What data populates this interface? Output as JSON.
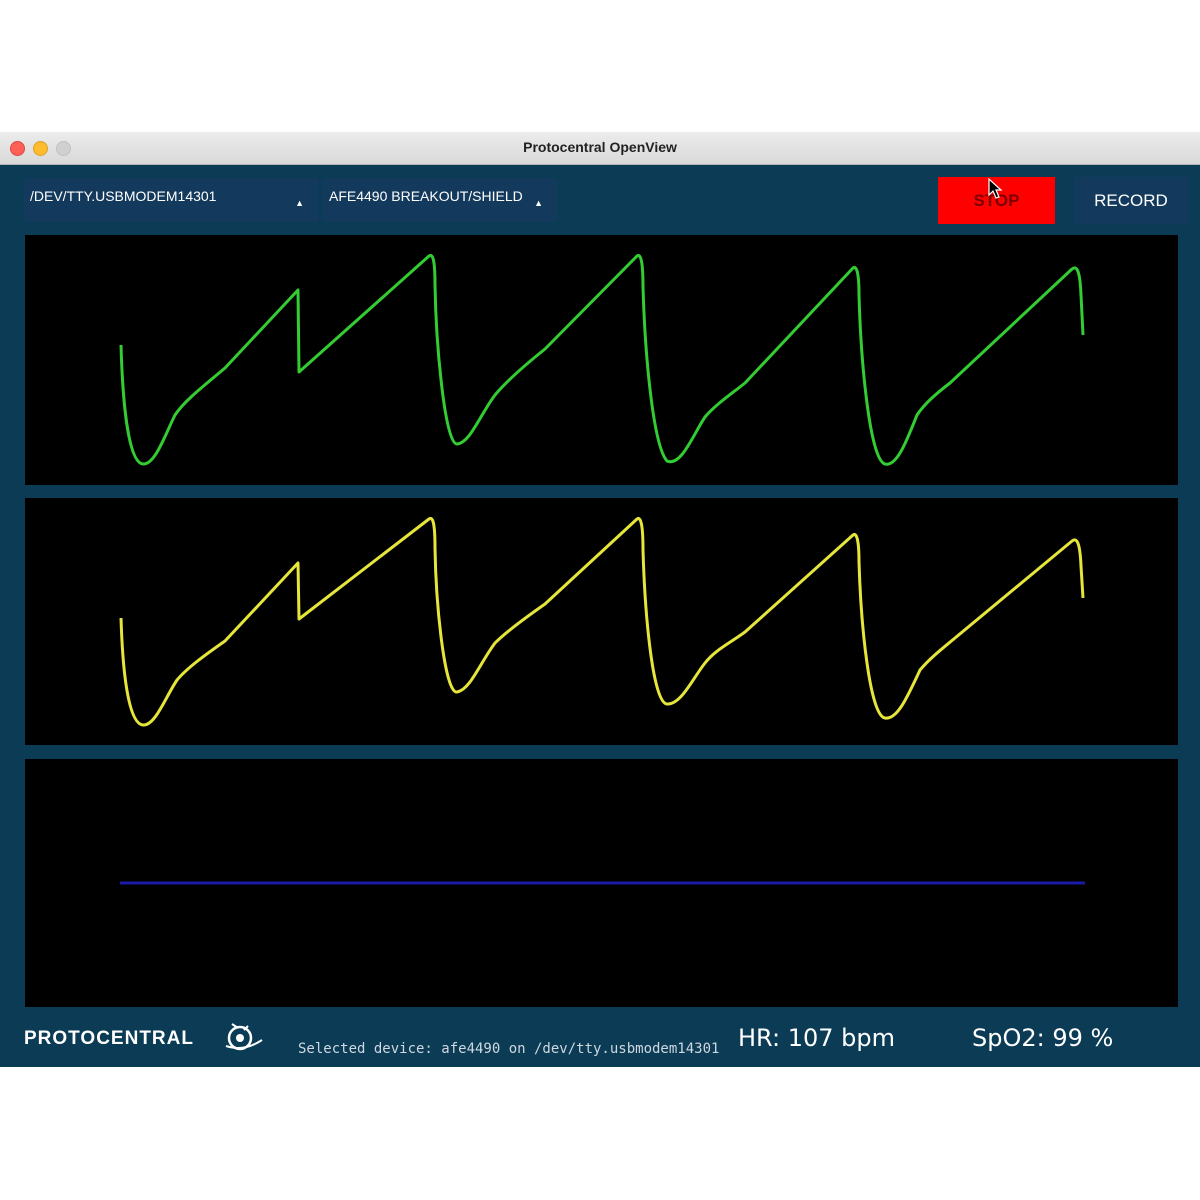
{
  "window": {
    "title": "Protocentral OpenView"
  },
  "toolbar": {
    "port_value": "/DEV/TTY.USBMODEM14301",
    "board_value": "AFE4490 BREAKOUT/SHIELD",
    "stop_label": "STOP",
    "record_label": "RECORD"
  },
  "colors": {
    "window_bg": "#0b3b55",
    "plot_bg": "#000000",
    "trace_1": "#33cc33",
    "trace_2": "#e5e53a",
    "trace_3": "#1a1aa6",
    "stop_bg": "#ff0000"
  },
  "footer": {
    "logo_text": "PROTOCENTRAL",
    "status_text": "Selected device: afe4490 on /dev/tty.usbmodem14301",
    "hr_text": "HR: 107 bpm",
    "spo2_text": "SpO2: 99 %"
  },
  "icons": [
    "cursor-icon",
    "protocentral-logo-icon",
    "dropdown-arrow-icon"
  ]
}
